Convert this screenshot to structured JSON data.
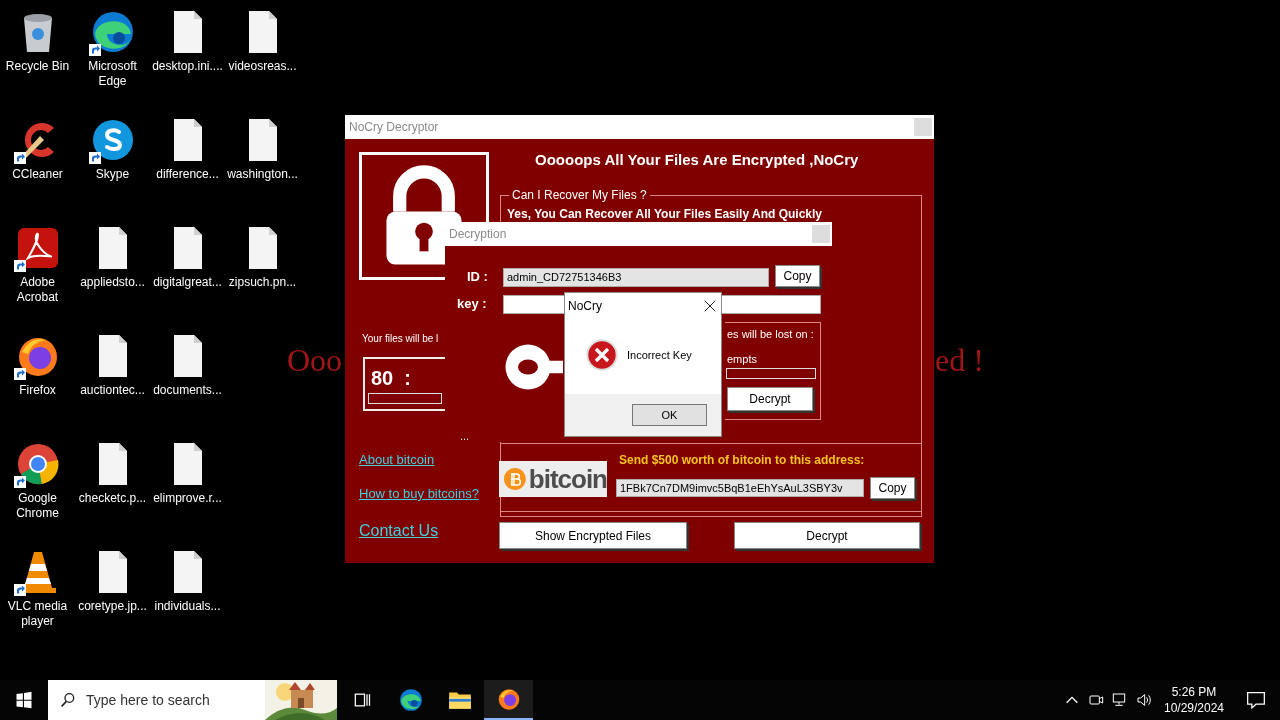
{
  "wallpaper": {
    "texts": [
      "Ooo",
      "ed !"
    ]
  },
  "desktop": {
    "icons": [
      {
        "label": "Recycle Bin",
        "kind": "recycle",
        "shortcut": false
      },
      {
        "label": "CCleaner",
        "kind": "ccleaner",
        "shortcut": true
      },
      {
        "label": "Adobe Acrobat",
        "kind": "acrobat",
        "shortcut": true
      },
      {
        "label": "Firefox",
        "kind": "firefox",
        "shortcut": true
      },
      {
        "label": "Google Chrome",
        "kind": "chrome",
        "shortcut": true
      },
      {
        "label": "VLC media player",
        "kind": "vlc",
        "shortcut": true
      },
      {
        "label": "Microsoft Edge",
        "kind": "edge",
        "shortcut": true
      },
      {
        "label": "Skype",
        "kind": "skype",
        "shortcut": true
      },
      {
        "label": "appliedsto...",
        "kind": "file",
        "shortcut": false
      },
      {
        "label": "auctiontec...",
        "kind": "file",
        "shortcut": false
      },
      {
        "label": "checketc.p...",
        "kind": "file",
        "shortcut": false
      },
      {
        "label": "coretype.jp...",
        "kind": "file",
        "shortcut": false
      },
      {
        "label": "desktop.ini....",
        "kind": "file",
        "shortcut": false
      },
      {
        "label": "difference...",
        "kind": "file",
        "shortcut": false
      },
      {
        "label": "digitalgreat...",
        "kind": "file",
        "shortcut": false
      },
      {
        "label": "documents...",
        "kind": "file",
        "shortcut": false
      },
      {
        "label": "elimprove.r...",
        "kind": "file",
        "shortcut": false
      },
      {
        "label": "individuals...",
        "kind": "file",
        "shortcut": false
      },
      {
        "label": "videosreas...",
        "kind": "file",
        "shortcut": false
      },
      {
        "label": "washington...",
        "kind": "file",
        "shortcut": false
      },
      {
        "label": "zipsuch.pn...",
        "kind": "file",
        "shortcut": false
      }
    ]
  },
  "main_window": {
    "title": "NoCry Decryptor",
    "headline": "Ooooops All Your Files Are Encrypted ,NoCry",
    "recover_group": {
      "legend": "Can I Recover My Files ?",
      "text": "Yes, You Can Recover All Your Files Easily And Quickly"
    },
    "timer": {
      "caption": "Your files will be l",
      "value": "80  :",
      "level": 0
    },
    "links": [
      "About bitcoin",
      "How to buy bitcoins?",
      "Contact Us"
    ],
    "payment": {
      "logo_text": "bitcoin",
      "instruction": "Send $500 worth of bitcoin to this address:",
      "address": "1FBk7Cn7DM9imvc5BqB1eEhYsAuL3SBY3v",
      "copy_button": "Copy"
    },
    "buttons": [
      "Show Encrypted Files",
      "Decrypt"
    ]
  },
  "decryption_window": {
    "title": "Decryption",
    "id_label": "ID :",
    "id_value": "admin_CD72751346B3",
    "copy_button": "Copy",
    "key_label": "key :",
    "status": {
      "lines": [
        "es will be lost on :",
        "empts"
      ],
      "level": 0,
      "button": "Decrypt"
    },
    "ellipsis": "..."
  },
  "message_box": {
    "title": "NoCry",
    "kind": "error",
    "message": "Incorrect Key",
    "button": "OK"
  },
  "taskbar": {
    "search_placeholder": "Type here to search",
    "apps": [
      {
        "kind": "task-view",
        "active": false
      },
      {
        "kind": "edge",
        "active": false
      },
      {
        "kind": "explorer",
        "active": false
      },
      {
        "kind": "firefox",
        "active": true
      }
    ],
    "clock": {
      "time": "5:26 PM",
      "date": "10/29/2024"
    }
  }
}
